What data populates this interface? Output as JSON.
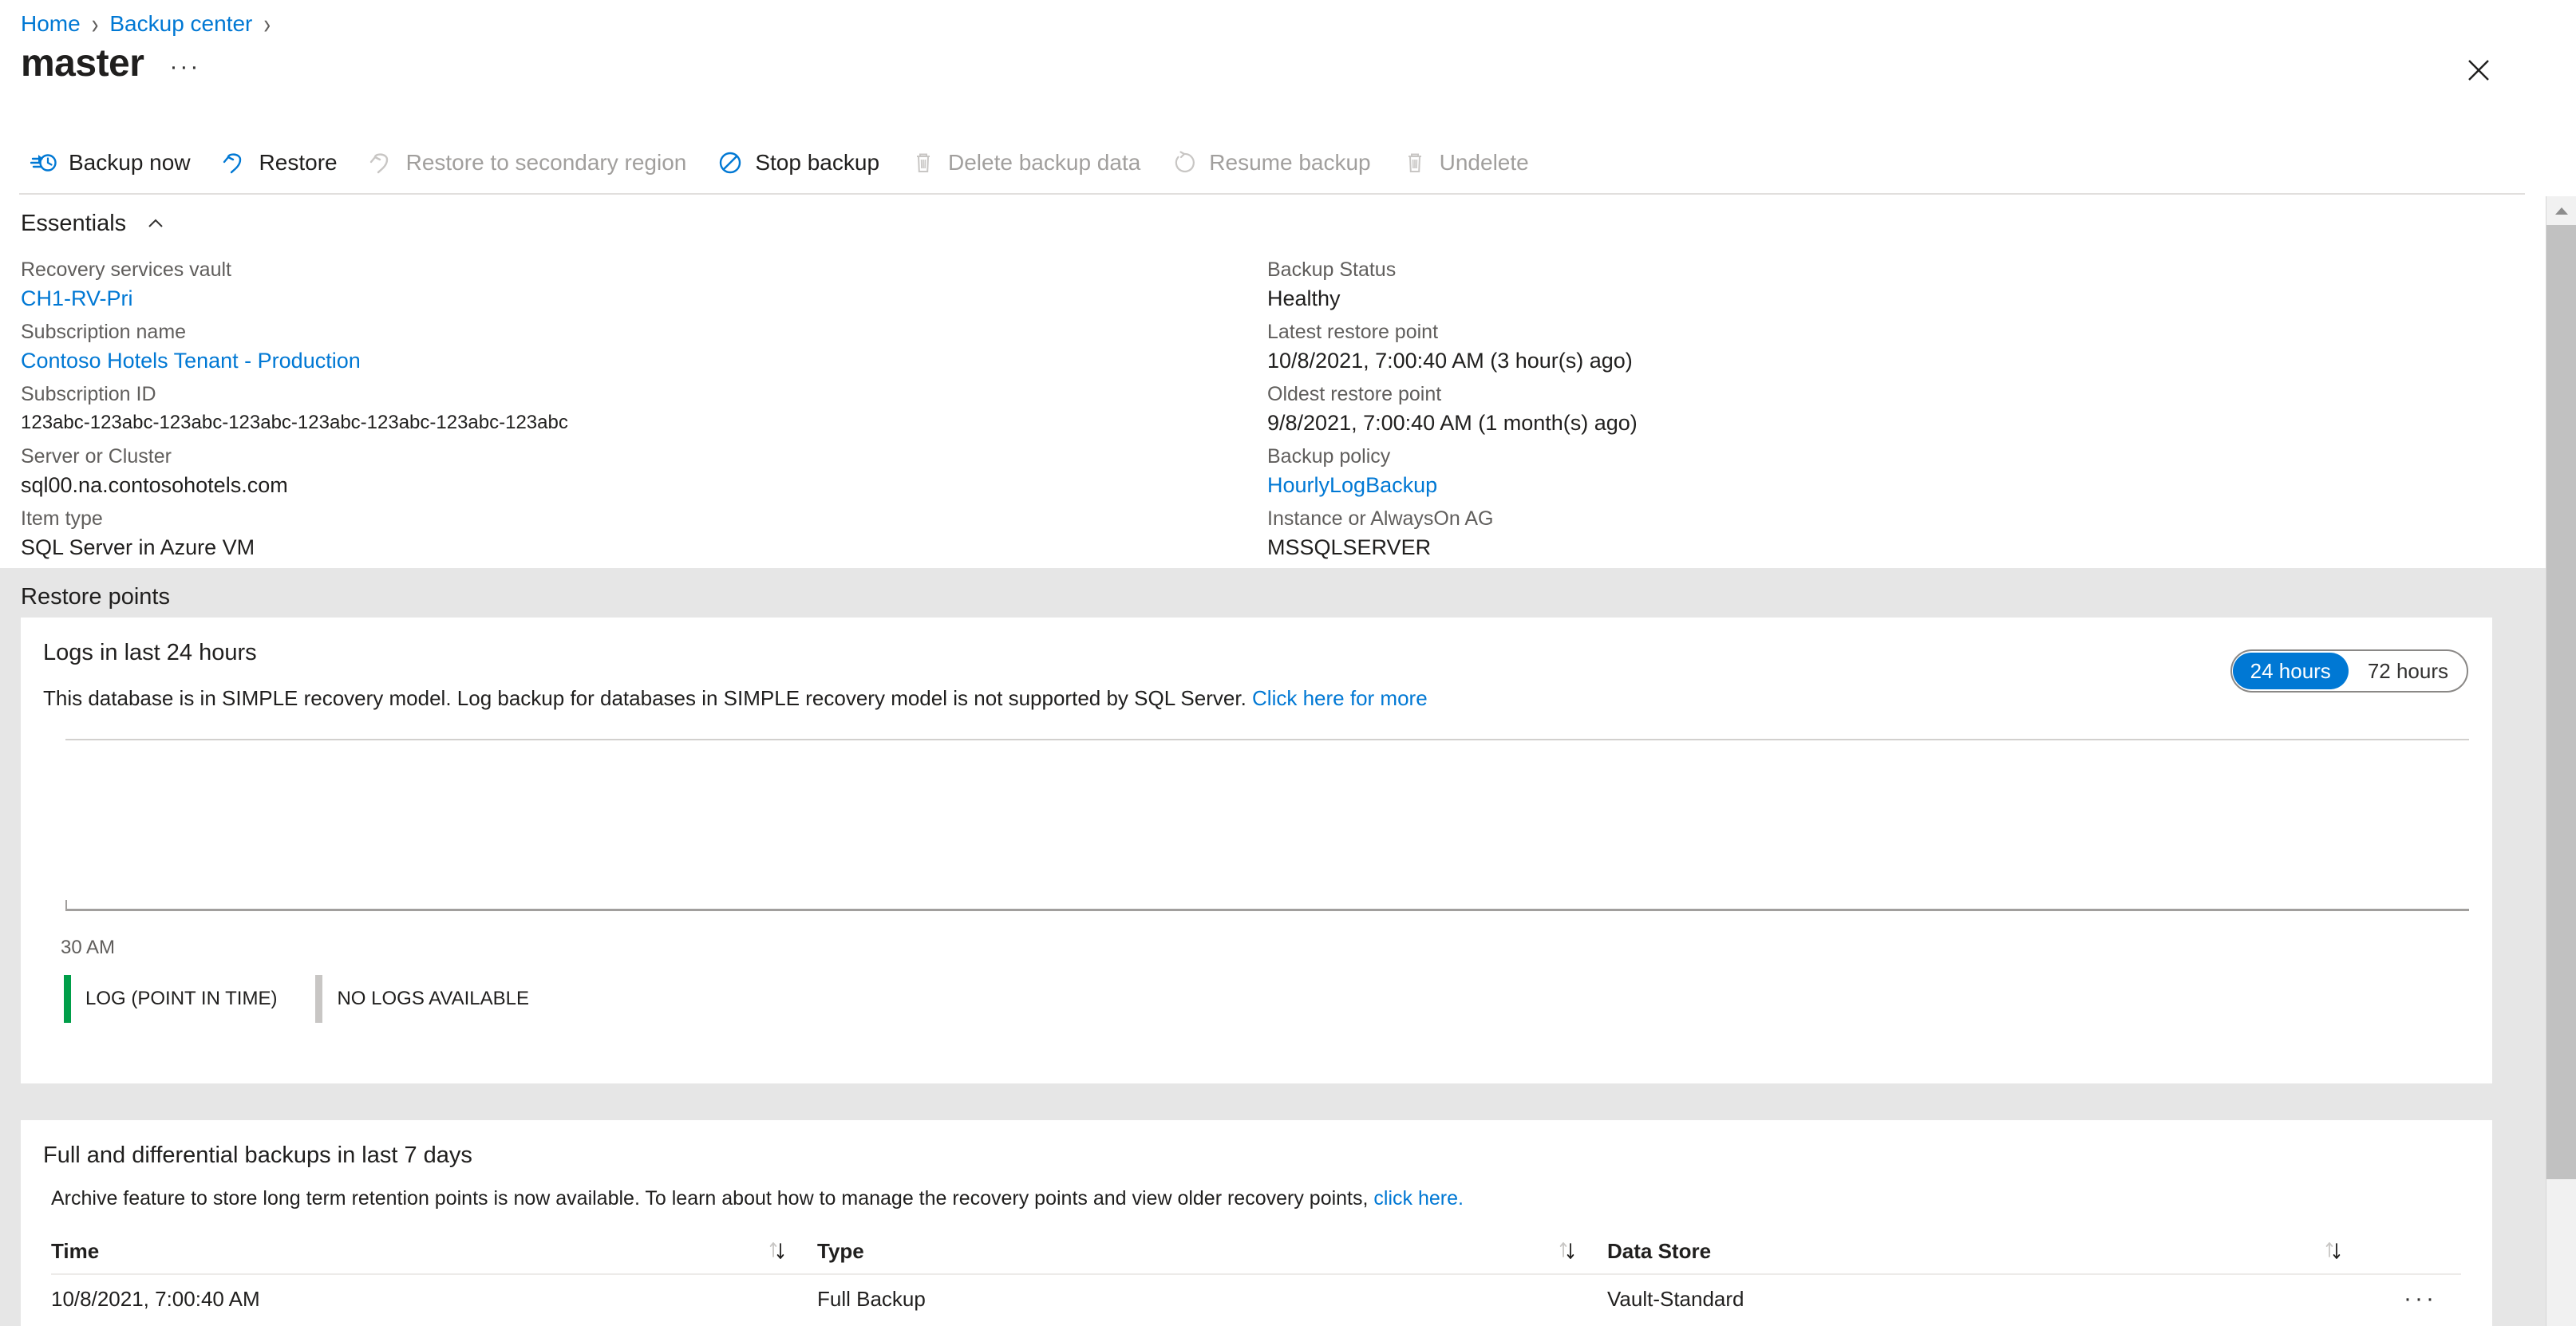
{
  "breadcrumb": {
    "items": [
      "Home",
      "Backup center"
    ],
    "separator": "›"
  },
  "header": {
    "title": "master",
    "ellipsis": "···",
    "close_icon": "close-icon"
  },
  "commandbar": {
    "items": [
      {
        "label": "Backup now",
        "icon": "backup-now-icon",
        "disabled": false
      },
      {
        "label": "Restore",
        "icon": "restore-icon",
        "disabled": false
      },
      {
        "label": "Restore to secondary region",
        "icon": "restore-secondary-icon",
        "disabled": true
      },
      {
        "label": "Stop backup",
        "icon": "stop-backup-icon",
        "disabled": false
      },
      {
        "label": "Delete backup data",
        "icon": "trash-icon",
        "disabled": true
      },
      {
        "label": "Resume backup",
        "icon": "resume-icon",
        "disabled": true
      },
      {
        "label": "Undelete",
        "icon": "trash-icon",
        "disabled": true
      }
    ]
  },
  "essentials": {
    "label": "Essentials",
    "chevron": "chevron-up-icon",
    "left": [
      {
        "label": "Recovery services vault",
        "value": "CH1-RV-Pri",
        "link": true
      },
      {
        "label": "Subscription name",
        "value": "Contoso Hotels Tenant - Production",
        "link": true
      },
      {
        "label": "Subscription ID",
        "value": "123abc-123abc-123abc-123abc-123abc-123abc-123abc-123abc",
        "link": false,
        "small": true
      },
      {
        "label": "Server or Cluster",
        "value": "sql00.na.contosohotels.com",
        "link": false
      },
      {
        "label": "Item type",
        "value": "SQL Server in Azure VM",
        "link": false
      }
    ],
    "right": [
      {
        "label": "Backup Status",
        "value": "Healthy",
        "link": false
      },
      {
        "label": "Latest restore point",
        "value": "10/8/2021, 7:00:40 AM (3 hour(s) ago)",
        "link": false
      },
      {
        "label": "Oldest restore point",
        "value": "9/8/2021, 7:00:40 AM (1 month(s) ago)",
        "link": false
      },
      {
        "label": "Backup policy",
        "value": "HourlyLogBackup",
        "link": true
      },
      {
        "label": "Instance or AlwaysOn AG",
        "value": "MSSQLSERVER",
        "link": false
      }
    ]
  },
  "restore_points": {
    "section_title": "Restore points",
    "logs_card": {
      "title": "Logs in last 24 hours",
      "note_text": "This database is in SIMPLE recovery model. Log backup for databases in SIMPLE recovery model is not supported by SQL Server. ",
      "note_link": "Click here for more",
      "toggle": {
        "options": [
          "24 hours",
          "72 hours"
        ],
        "selected": "24 hours"
      },
      "chart_data": {
        "type": "bar",
        "title": "Logs in last 24 hours",
        "categories": [
          "30 AM"
        ],
        "values": [
          0
        ],
        "xlabel": "",
        "ylabel": "",
        "x_tick_labels": [
          "30 AM"
        ],
        "grid": false,
        "legend_position": "bottom",
        "series": [
          {
            "name": "LOG (POINT IN TIME)",
            "color": "#009e49",
            "values": [
              0
            ]
          },
          {
            "name": "NO LOGS AVAILABLE",
            "color": "#c8c6c4",
            "values": [
              0
            ]
          }
        ]
      },
      "legend": [
        {
          "label": "LOG (POINT IN TIME)",
          "color": "#009e49"
        },
        {
          "label": "NO LOGS AVAILABLE",
          "color": "#c8c6c4"
        }
      ]
    },
    "backups_card": {
      "title": "Full and differential backups in last 7 days",
      "note_text": "Archive feature to store long term retention points is now available. To learn about how to manage the recovery points and view older recovery points, ",
      "note_link": "click here.",
      "columns": [
        "Time",
        "Type",
        "Data Store"
      ],
      "rows": [
        {
          "time": "10/8/2021, 7:00:40 AM",
          "type": "Full Backup",
          "data_store": "Vault-Standard",
          "menu": "···"
        }
      ]
    }
  },
  "scrollbar": {
    "up_icon": "chevron-up-icon"
  },
  "colors": {
    "accent": "#0078d4",
    "link": "#0078d4",
    "gray_bg": "#e6e6e6",
    "legend_green": "#009e49",
    "legend_gray": "#c8c6c4"
  }
}
